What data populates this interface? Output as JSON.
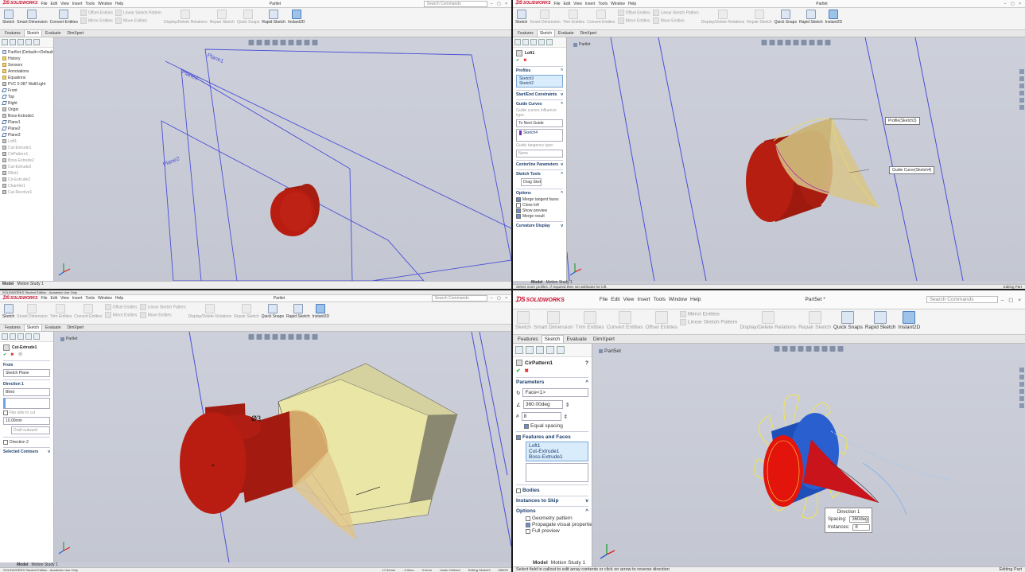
{
  "q1": {
    "app": "SOLIDWORKS",
    "menu": [
      "File",
      "Edit",
      "View",
      "Insert",
      "Tools",
      "Window",
      "Help"
    ],
    "doc_title": "Partlet",
    "search_placeholder": "Search Commands",
    "commands": [
      "Sketch",
      "Smart Dimension",
      "Convert Entities",
      "Offset Entities",
      "Mirror Entities",
      "Linear Sketch Pattern",
      "Move Entities",
      "Display/Delete Relations",
      "Repair Sketch",
      "Quick Snaps",
      "Rapid Sketch",
      "Instant2D"
    ],
    "tabs": [
      "Features",
      "Sketch",
      "Evaluate",
      "DimXpert"
    ],
    "tree": [
      {
        "label": "Part5et (Default<<Default>_Disp",
        "state": "normal"
      },
      {
        "label": "History",
        "state": "normal"
      },
      {
        "label": "Sensors",
        "state": "normal"
      },
      {
        "label": "Annotations",
        "state": "normal"
      },
      {
        "label": "Equations",
        "state": "normal"
      },
      {
        "label": "PVC 0.087 Wall/Light",
        "state": "normal"
      },
      {
        "label": "Front",
        "state": "normal"
      },
      {
        "label": "Top",
        "state": "normal"
      },
      {
        "label": "Right",
        "state": "normal"
      },
      {
        "label": "Origin",
        "state": "normal"
      },
      {
        "label": "Boss-Extrude1",
        "state": "normal"
      },
      {
        "label": "Plane1",
        "state": "normal"
      },
      {
        "label": "Plane2",
        "state": "normal"
      },
      {
        "label": "Plane3",
        "state": "normal"
      },
      {
        "label": "Loft1",
        "state": "faded"
      },
      {
        "label": "Cut-Extrude1",
        "state": "faded"
      },
      {
        "label": "CirPattern1",
        "state": "faded"
      },
      {
        "label": "Boss-Extrude2",
        "state": "faded"
      },
      {
        "label": "Cut-Extrude2",
        "state": "faded"
      },
      {
        "label": "Fillet1",
        "state": "faded"
      },
      {
        "label": "Cir-Extrude3",
        "state": "faded"
      },
      {
        "label": "Chamfer1",
        "state": "faded"
      },
      {
        "label": "Cut-Revolve1",
        "state": "faded"
      }
    ],
    "planes": [
      "Plane1",
      "Plane2",
      "Plane3"
    ],
    "model_tabs": [
      "Model",
      "Motion Study 1"
    ]
  },
  "q2": {
    "app": "SOLIDWORKS",
    "menu": [
      "File",
      "Edit",
      "View",
      "Insert",
      "Tools",
      "Window",
      "Help"
    ],
    "doc_title": "Partlet",
    "commands": [
      "Sketch",
      "Smart Dimension",
      "Trim Entities",
      "Convert Entities",
      "Offset Entities",
      "Mirror Entities",
      "Linear Sketch Pattern",
      "Move Entities",
      "Display/Delete Relations",
      "Repair Sketch",
      "Quick Snaps",
      "Rapid Sketch",
      "Instant2D"
    ],
    "tabs": [
      "Features",
      "Sketch",
      "Evaluate",
      "DimXpert"
    ],
    "breadcrumb": "Partlet",
    "pm": {
      "title": "Loft1",
      "profiles_header": "Profiles",
      "profiles": [
        "Sketch3",
        "Sketch2"
      ],
      "start_end": "Start/End Constraints",
      "guide_header": "Guide Curves",
      "guide_type_label": "Guide curves influence type:",
      "guide_type": "To Next Guide",
      "guides": [
        "Sketch4"
      ],
      "guide_tangency": "Guide tangency type:",
      "guide_tangency_value": "None",
      "centerline": "Centerline Parameters",
      "sketch_tools": "Sketch Tools",
      "drag_sketch": "Drag Sketch",
      "options_header": "Options",
      "options": [
        {
          "label": "Merge tangent faces",
          "checked": true
        },
        {
          "label": "Close loft",
          "checked": false
        },
        {
          "label": "Show preview",
          "checked": true
        },
        {
          "label": "Merge result",
          "checked": true
        }
      ],
      "curvature": "Curvature Display"
    },
    "callouts": [
      "Profile(Sketch3)",
      "Guide Curve(Sketch4)"
    ],
    "status_left": "Select more profiles. If required then set attributes for loft.",
    "status_right": "Editing Part",
    "model_tabs": [
      "Model",
      "Motion Study 1"
    ]
  },
  "q3": {
    "app": "SOLIDWORKS",
    "edition": "SOLIDWORKS Student Edition - Academic Use Only",
    "menu": [
      "File",
      "Edit",
      "View",
      "Insert",
      "Tools",
      "Window",
      "Help"
    ],
    "search_placeholder": "Search Commands",
    "doc_title": "Partlet",
    "commands": [
      "Sketch",
      "Smart Dimension",
      "Trim Entities",
      "Convert Entities",
      "Offset Entities",
      "Mirror Entities",
      "Linear Sketch Pattern",
      "Move Entities",
      "Display/Delete Relations",
      "Repair Sketch",
      "Quick Snaps",
      "Rapid Sketch",
      "Instant2D"
    ],
    "tabs": [
      "Features",
      "Sketch",
      "Evaluate",
      "DimXpert"
    ],
    "breadcrumb": "Partlet",
    "pm": {
      "title": "Cut-Extrude1",
      "from_header": "From",
      "from_value": "Sketch Plane",
      "dir1_header": "Direction 1",
      "dir1_type": "Blind",
      "flip_side": "Flip side to cut",
      "depth": "10.00mm",
      "draft": "Draft outward",
      "dir2_header": "Direction 2",
      "selected_contours": "Selected Contours"
    },
    "dimension": "Ø3",
    "status": [
      "17.62mm",
      "-3.9mm",
      "0.0mm",
      "Under Defined",
      "Editing Sketch3",
      "MMGS"
    ],
    "status_left": "SOLIDWORKS Student Edition - Academic Use Only",
    "model_tabs": [
      "Model",
      "Motion Study 1"
    ]
  },
  "q4": {
    "app": "SOLIDWORKS",
    "menu": [
      "File",
      "Edit",
      "View",
      "Insert",
      "Tools",
      "Window",
      "Help"
    ],
    "doc_title": "Part5et *",
    "search_placeholder": "Search Commands",
    "commands": [
      "Sketch",
      "Smart Dimension",
      "Trim Entities",
      "Convert Entities",
      "Offset Entities",
      "Mirror Entities",
      "Linear Sketch Pattern",
      "Display/Delete Relations",
      "Repair Sketch",
      "Quick Snaps",
      "Rapid Sketch",
      "Instant2D"
    ],
    "tabs": [
      "Features",
      "Sketch",
      "Evaluate",
      "DimXpert"
    ],
    "breadcrumb": "Part5et",
    "pm": {
      "title": "CirPattern1",
      "params_header": "Parameters",
      "axis": "Face<1>",
      "angle": "360.00deg",
      "instances": "8",
      "equal_spacing": "Equal spacing",
      "faf_header": "Features and Faces",
      "features": [
        "Loft1",
        "Cut-Extrude1",
        "Boss-Extrude1"
      ],
      "bodies_header": "Bodies",
      "skip_header": "Instances to Skip",
      "options_header": "Options",
      "options": [
        {
          "label": "Geometry pattern",
          "checked": false
        },
        {
          "label": "Propagate visual properties",
          "checked": true
        },
        {
          "label": "Full preview",
          "checked": false
        }
      ]
    },
    "callout": {
      "title": "Direction 1",
      "spacing_label": "Spacing:",
      "spacing": "360deg",
      "instances_label": "Instances:",
      "instances": "8"
    },
    "status_left": "Select field in callout to edit array contents or click on arrow to reverse direction",
    "status_right": "Editing Part",
    "model_tabs": [
      "Model",
      "Motion Study 1"
    ]
  },
  "colors": {
    "accent": "#c8102e",
    "plane": "#4b4fd6",
    "solid_red": "#b91c10",
    "loft_tan": "#d8c58a",
    "pattern_yellow": "#f1e54a",
    "face_blue": "#2a5fd0"
  }
}
